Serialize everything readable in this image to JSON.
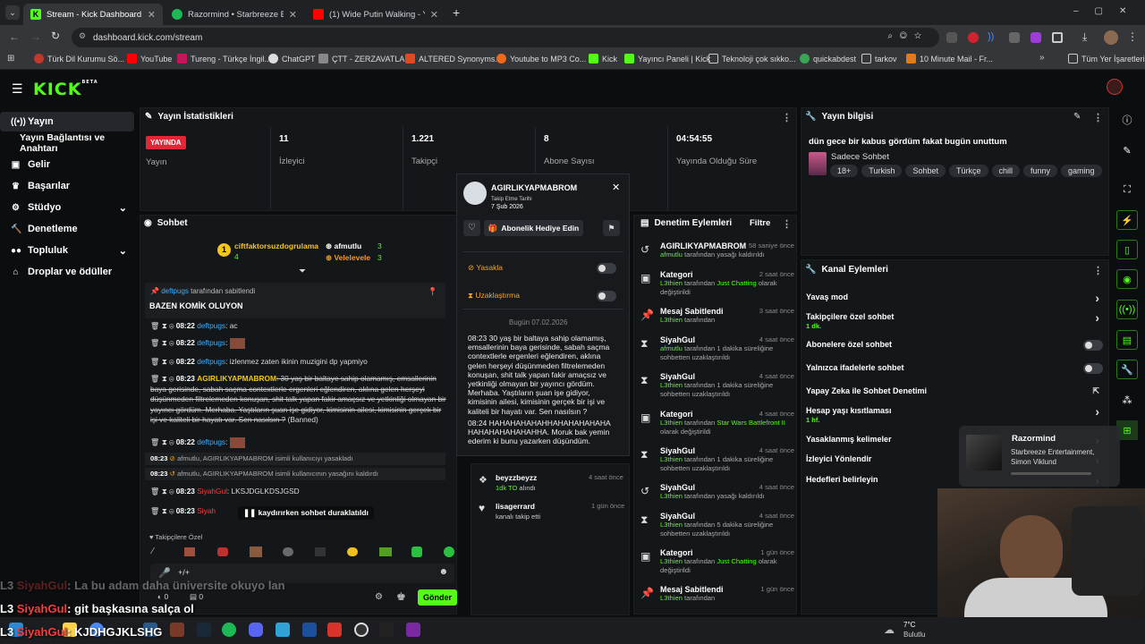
{
  "browser": {
    "tabs": [
      {
        "title": "Stream - Kick Dashboard",
        "color": "#53fc18"
      },
      {
        "title": "Razormind • Starbreeze Entertai",
        "color": "#1db954"
      },
      {
        "title": "(1) Wide Putin Walking - YouTu",
        "color": "#ff0000"
      }
    ],
    "new_tab": "+",
    "url": "dashboard.kick.com/stream",
    "bookmarks": [
      "Türk Dil Kurumu Sö...",
      "YouTube",
      "Tureng - Türkçe İngil...",
      "ChatGPT",
      "ÇTT - ZERZAVATLAR",
      "ALTERED Synonyms...",
      "Youtube to MP3 Co...",
      "Kick",
      "Yayıncı Paneli | Kick",
      "Teknoloji çok sıkko...",
      "quickabdest",
      "tarkov",
      "10 Minute Mail - Fr..."
    ],
    "all_bookmarks": "Tüm Yer İşaretleri"
  },
  "kick": {
    "logo": "KICK",
    "logo_beta": "BETA"
  },
  "sidebar": {
    "items": [
      {
        "label": "Yayın",
        "icon": "broadcast-icon"
      },
      {
        "label": "Yayın Bağlantısı ve Anahtarı",
        "icon": ""
      },
      {
        "label": "Gelir",
        "icon": "wallet-icon"
      },
      {
        "label": "Başarılar",
        "icon": "trophy-icon"
      },
      {
        "label": "Stüdyo",
        "icon": "studio-icon"
      },
      {
        "label": "Denetleme",
        "icon": "hammer-icon"
      },
      {
        "label": "Topluluk",
        "icon": "community-icon"
      },
      {
        "label": "Droplar ve ödüller",
        "icon": "gift-icon"
      }
    ]
  },
  "stats": {
    "title": "Yayın İstatistikleri",
    "live_badge": "YAYINDA",
    "live_label": "Yayın",
    "viewers": "11",
    "viewers_label": "İzleyici",
    "followers": "1.221",
    "followers_label": "Takipçi",
    "subs": "8",
    "subs_label": "Abone Sayısı",
    "uptime": "04:54:55",
    "uptime_label": "Yayında Olduğu Süre"
  },
  "info": {
    "title": "Yayın bilgisi",
    "stream_title": "dün gece bir kabus gördüm fakat bugün unuttum",
    "category": "Sadece Sohbet",
    "tags": [
      "18+",
      "Turkish",
      "Sohbet",
      "Türkçe",
      "chill",
      "funny",
      "gaming"
    ]
  },
  "chat": {
    "title": "Sohbet",
    "gifters": [
      {
        "name": "ciftfaktorsuzdogrulama",
        "count": "4"
      },
      {
        "name": "afmutlu",
        "count": "3"
      },
      {
        "name": "Velelevele",
        "count": "3"
      }
    ],
    "gifter_rank": "1",
    "pinned_by_user": "deftpugs",
    "pinned_by_text": "tarafından sabitlendi",
    "pinned_message": "BAZEN KOMİK OLUYON",
    "messages": [
      {
        "time": "08:22",
        "user": "deftpugs",
        "text": ": ac"
      },
      {
        "time": "08:22",
        "user": "deftpugs",
        "text": ":"
      },
      {
        "time": "08:22",
        "user": "deftpugs",
        "text": ": izlenmez zaten ikinin muzigini dp yapmiyo"
      },
      {
        "time": "08:23",
        "user": "AGIRLIKYAPMABROM",
        "text": ": 30 yaş bir baltaye sahip olamamış, emsallerinin baya gerisinde, sabah saçma contextlerle ergenleri eğlendiren, aklına gelen herşeyi düşünmeden filtrelemeden konuşan, shit talk yapan fakir amaçsız ve yetkinliği olmayan bir yayıncı gördüm. Merhaba. Yaştıların şuan işe gidiyor, kimisinin ailesi, kimisinin gerçek bir işi ve kaliteli bir hayatı var. Sen nasılsın ?",
        "banned": "(Banned)"
      },
      {
        "time": "08:22",
        "user": "deftpugs",
        "text": ":"
      }
    ],
    "sys1_time": "08:23",
    "sys1_text": "afmutlu, AGIRLIKYAPMABROM isimli kullanıcıyı yasakladı",
    "sys2_time": "08:23",
    "sys2_text": "afmutlu, AGIRLIKYAPMABROM isimli kullanıcının yasağını kaldırdı",
    "msg6_time": "08:23",
    "msg6_user": "SiyahGul",
    "msg6_text": ": LKSJDGLKDSJGSD",
    "msg7_time": "08:23",
    "msg7_user": "Siyah",
    "paused": "kaydırırken sohbet duraklatıldı",
    "followers_only": "Takipçilere Özel",
    "input_placeholder": "+/+",
    "count_a": "0",
    "count_b": "0",
    "send": "Gönder"
  },
  "popup": {
    "user": "AGIRLIKYAPMABROM",
    "follow_label": "Takip Etme Tarihi",
    "follow_date": "7 Şub 2026",
    "gift_sub": "Abonelik Hediye Edin",
    "ban": "Yasakla",
    "timeout": "Uzaklaştırma",
    "today": "Bugün 07.02.2026",
    "msg1": "08:23 30 yaş bir baltaya sahip olamamış, emsallerinin baya gerisinde, sabah saçma contextlerle ergenleri eğlendiren, aklına gelen herşeyi düşünmeden filtrelemeden konuşan, shit talk yapan fakir amaçsız ve yetkinliği olmayan bir yayıncı gördüm. Merhaba. Yaştıların şuan işe gidiyor, kimisinin ailesi, kimisinin gerçek bir işi ve kaliteli bir hayatı var. Sen nasılsın ?",
    "msg2": "08:24 HAHAHAHAHAHHAHAHAHAHAHA HAHAHAHAHAHAHHA. Moruk bak yemin ederim ki bunu yazarken düşündüm."
  },
  "activity": [
    {
      "user": "beyzzbeyzz",
      "detail_a": "1dk TO",
      "detail_b": "alındı",
      "when": "4 saat önce"
    },
    {
      "user": "lisagerrard",
      "detail_a": "",
      "detail_b": "kanalı takip etti",
      "when": "1 gün önce"
    }
  ],
  "moderation": {
    "title": "Denetim Eylemleri",
    "filter": "Filtre",
    "items": [
      {
        "icon": "unban-icon",
        "title": "AGIRLIKYAPMABROM",
        "when": "58 saniye önce",
        "actor": "afmutlu",
        "desc": "tarafından yasağı kaldırıldı"
      },
      {
        "icon": "category-icon",
        "title": "Kategori",
        "when": "2 saat önce",
        "actor": "L3thien",
        "desc": "tarafından",
        "extra": "Just Chatting",
        "desc2": "olarak değiştirildi"
      },
      {
        "icon": "pin-icon",
        "title": "Mesaj Sabitlendi",
        "when": "3 saat önce",
        "actor": "L3thien",
        "desc": "tarafından"
      },
      {
        "icon": "timeout-icon",
        "title": "SiyahGul",
        "when": "4 saat önce",
        "actor": "afmutlu",
        "desc": "tarafından 1 dakika süreliğine sohbetten uzaklaştırıldı"
      },
      {
        "icon": "timeout-icon",
        "title": "SiyahGul",
        "when": "4 saat önce",
        "actor": "L3thien",
        "desc": "tarafından 1 dakika süreliğine sohbetten uzaklaştırıldı"
      },
      {
        "icon": "category-icon",
        "title": "Kategori",
        "when": "4 saat önce",
        "actor": "L3thien",
        "desc": "tarafından",
        "extra": "Star Wars Battlefront II",
        "desc2": "olarak değiştirildi"
      },
      {
        "icon": "timeout-icon",
        "title": "SiyahGul",
        "when": "4 saat önce",
        "actor": "L3thien",
        "desc": "tarafından 1 dakika süreliğine sohbetten uzaklaştırıldı"
      },
      {
        "icon": "unban-icon",
        "title": "SiyahGul",
        "when": "4 saat önce",
        "actor": "L3thien",
        "desc": "tarafından yasağı kaldırıldı"
      },
      {
        "icon": "timeout-icon",
        "title": "SiyahGul",
        "when": "4 saat önce",
        "actor": "L3thien",
        "desc": "tarafından 5 dakika süreliğine sohbetten uzaklaştırıldı"
      },
      {
        "icon": "category-icon",
        "title": "Kategori",
        "when": "1 gün önce",
        "actor": "L3thien",
        "desc": "tarafından",
        "extra": "Just Chatting",
        "desc2": "olarak değiştirildi"
      },
      {
        "icon": "pin-icon",
        "title": "Mesaj Sabitlendi",
        "when": "1 gün önce",
        "actor": "L3thien",
        "desc": "tarafından"
      }
    ]
  },
  "channel": {
    "title": "Kanal Eylemleri",
    "items": [
      {
        "label": "Yavaş mod",
        "sub": "",
        "control": "chevron"
      },
      {
        "label": "Takipçilere özel sohbet",
        "sub": "1 dk.",
        "control": "chevron"
      },
      {
        "label": "Abonelere özel sohbet",
        "sub": "",
        "control": "toggle"
      },
      {
        "label": "Yalnızca ifadelerle sohbet",
        "sub": "",
        "control": "toggle"
      },
      {
        "label": "Yapay Zeka ile Sohbet Denetimi",
        "sub": "",
        "control": "external"
      },
      {
        "label": "Hesap yaşı kısıtlaması",
        "sub": "1 hf.",
        "control": "chevron"
      },
      {
        "label": "Yasaklanmış kelimeler",
        "sub": "",
        "control": "chevron"
      },
      {
        "label": "İzleyici Yönlendir",
        "sub": "",
        "control": "chevron"
      },
      {
        "label": "Hedefleri belirleyin",
        "sub": "",
        "control": "chevron"
      }
    ]
  },
  "media": {
    "title": "Razormind",
    "artist": "Starbreeze Entertainment, Simon Viklund"
  },
  "overlay": {
    "line1_user": "SiyahGul",
    "line1_text": ": La bu adam daha üniversite okuyo lan",
    "line2_user": "SiyahGul",
    "line2_text": ": git başkasına salça ol",
    "line3_user": "SiyahGul",
    "line3_text": ": KJDHGJKLSHG"
  },
  "weather": {
    "temp": "7°C",
    "desc": "Bulutlu"
  },
  "colors": {
    "kick_green": "#53fc18",
    "live_red": "#e32636",
    "username_blue": "#3ab0ff",
    "siyahgul_red": "#ff3b3b"
  }
}
